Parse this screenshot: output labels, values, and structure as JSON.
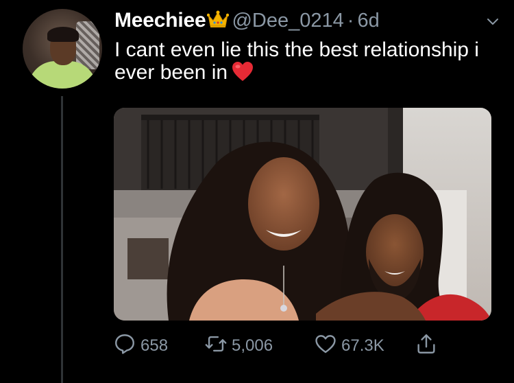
{
  "tweet": {
    "display_name": "Meechiee",
    "badge_emoji": "crown-emoji",
    "handle": "@Dee_0214",
    "separator": "·",
    "time": "6d",
    "text": "I cant even lie this the best relationship i ever been in",
    "trailing_emoji": "red-heart-emoji",
    "menu_icon": "chevron-down-icon"
  },
  "actions": {
    "reply": {
      "icon": "reply-icon",
      "count": "658"
    },
    "retweet": {
      "icon": "retweet-icon",
      "count": "5,006"
    },
    "like": {
      "icon": "heart-icon",
      "count": "67.3K"
    },
    "share": {
      "icon": "share-icon"
    }
  },
  "colors": {
    "background": "#000000",
    "text": "#ffffff",
    "secondary": "#8b98a5",
    "thread_line": "#2f3336",
    "heart": "#e0245e"
  }
}
